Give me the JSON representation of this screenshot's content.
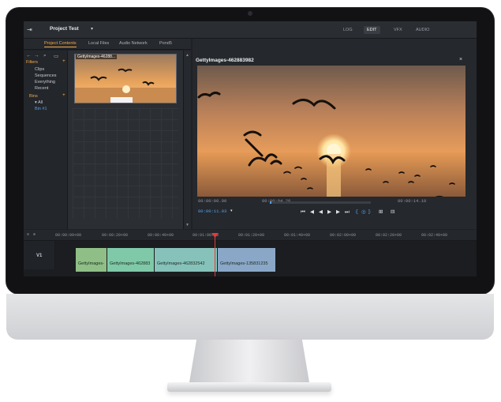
{
  "app": {
    "project_title": "Project Test",
    "project_caret": "▾",
    "mode_tabs": [
      "LOG",
      "EDIT",
      "VFX",
      "AUDIO"
    ],
    "active_mode": "EDIT"
  },
  "library": {
    "tabs": [
      "Project Contents",
      "Local Files",
      "Audio Network",
      "Pond5"
    ],
    "sidebar": {
      "filters_label": "Filters",
      "filter_items": [
        "Clips",
        "Sequences",
        "Everything",
        "Recent"
      ],
      "bins_label": "Bins",
      "bin_items": [
        "▾ All",
        "Bin #1"
      ],
      "plus": "+"
    },
    "thumbnail_label": "GettyImages-46288..."
  },
  "viewer": {
    "clip_title": "GettyImages-462883982",
    "close": "×",
    "tc_left": "00:00:00.00",
    "tc_in": "00:00:04.20",
    "tc_out": "00:00:14.10",
    "tc_current": "00:00:11.03",
    "controls": [
      "⏮",
      "◀",
      "◀",
      "▶",
      "▶",
      "⏭"
    ],
    "progress": 0.01
  },
  "timeline": {
    "ruler_ticks": [
      "00:00:00+00",
      "00:00:20+00",
      "00:00:40+00",
      "00:01:00+00",
      "00:01:20+00",
      "00:01:40+00",
      "00:02:00+00",
      "00:02:20+00",
      "00:02:40+00"
    ],
    "track_label": "V1",
    "clips": [
      {
        "label": "GettyImages-",
        "color": "#8fbf86"
      },
      {
        "label": "GettyImages-462883",
        "color": "#7fc9a8"
      },
      {
        "label": "GettyImages-462832542",
        "color": "#86c2ba"
      },
      {
        "label": "GettyImages-135831235",
        "color": "#8aa7c8"
      }
    ]
  },
  "colors": {
    "accent_orange": "#f3a94a",
    "accent_blue": "#5aa0e8",
    "playhead": "#e23b3b"
  },
  "hardware": {
    "logo_glyph": "",
    "icons": [
      "apple-logo-icon",
      "camera-icon"
    ]
  }
}
